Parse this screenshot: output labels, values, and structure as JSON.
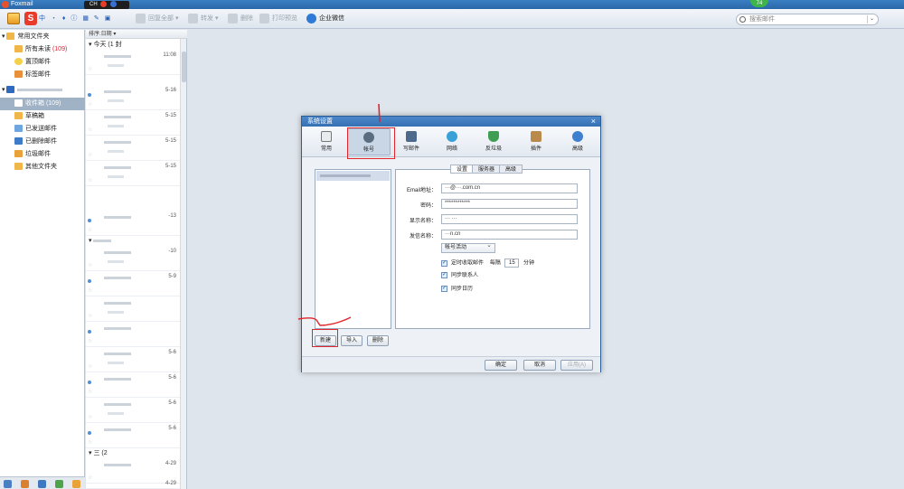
{
  "window": {
    "title": "Foxmail"
  },
  "ime": {
    "label": "CH"
  },
  "toolbar": {
    "sogou": "S",
    "ime_icons": "中 ・ ♦ ⓘ ▦ ✎ ▣",
    "reply_all": "回复全部",
    "forward": "转发",
    "delete": "删除",
    "print": "打印预览",
    "enterprise_wechat": "企业微信",
    "search_placeholder": "搜索邮件",
    "badge": "74"
  },
  "sidebar": {
    "common_folders": "常用文件夹",
    "all_unread": "所有未读",
    "all_unread_count": "(109)",
    "pinned": "置顶邮件",
    "tagged": "标签邮件",
    "inbox": "收件箱",
    "inbox_count": "(109)",
    "drafts": "草稿箱",
    "sent": "已发送邮件",
    "deleted": "已删除邮件",
    "junk": "垃圾邮件",
    "other": "其他文件夹"
  },
  "msglist": {
    "sort_label": "排序:日期",
    "groups": [
      {
        "label": "今天 (1 封"
      },
      {
        "label": "三 (2"
      }
    ],
    "dates": [
      "11:08",
      "5-16",
      "5-15",
      "5-15",
      "5-15",
      "-13",
      "-10",
      "5-9",
      "5-6",
      "5-6",
      "5-6",
      "5-6",
      "4-29",
      "4-29"
    ]
  },
  "dialog": {
    "title": "系统设置",
    "tabs": {
      "general": "常用",
      "account": "帐号",
      "compose": "写邮件",
      "network": "网络",
      "antispam": "反垃圾",
      "plugins": "插件",
      "advanced": "高级"
    },
    "subtabs": {
      "settings": "设置",
      "server": "服务器",
      "advanced": "高级"
    },
    "labels": {
      "email": "Email地址：",
      "password": "密码：",
      "display_name": "显示名称：",
      "sender_name": "发信名称："
    },
    "values": {
      "email": "···@···.com.cn",
      "password": "************",
      "display_name": "··· ···",
      "sender_name": "···n.cn"
    },
    "account_status": "帐号活动",
    "auto_receive": "定时收取邮件",
    "every": "每隔",
    "interval": "15",
    "minutes": "分钟",
    "sync_contacts": "同步联系人",
    "sync_calendar": "同步日历",
    "buttons": {
      "new": "新建",
      "import": "导入",
      "delete": "删除",
      "ok": "确定",
      "cancel": "取消",
      "apply": "应用(A)"
    },
    "annotation_number": "1"
  },
  "colors": {
    "accent": "#3571b2",
    "selected": "#9fb2c6",
    "unread_count": "#dd2233",
    "annotation": "#e0262b"
  }
}
